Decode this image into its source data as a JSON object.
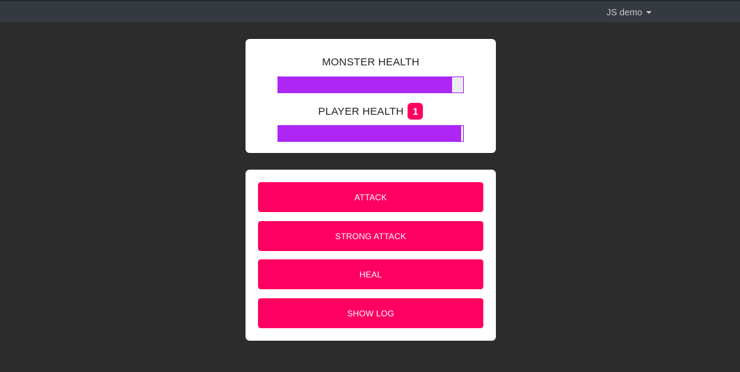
{
  "nav": {
    "menu_label": "JS demo",
    "menu_icon": "caret-down-icon"
  },
  "health": {
    "monster_label": "MONSTER HEALTH",
    "monster_percent": 94,
    "player_label": "PLAYER HEALTH",
    "player_badge": "1",
    "player_percent": 99
  },
  "actions": {
    "attack_label": "ATTACK",
    "strong_attack_label": "STRONG ATTACK",
    "heal_label": "HEAL",
    "show_log_label": "SHOW LOG"
  },
  "colors": {
    "background": "#2c2c2c",
    "topbar": "#343a40",
    "accent": "#ff0062",
    "health_fill": "#ad26f5"
  }
}
